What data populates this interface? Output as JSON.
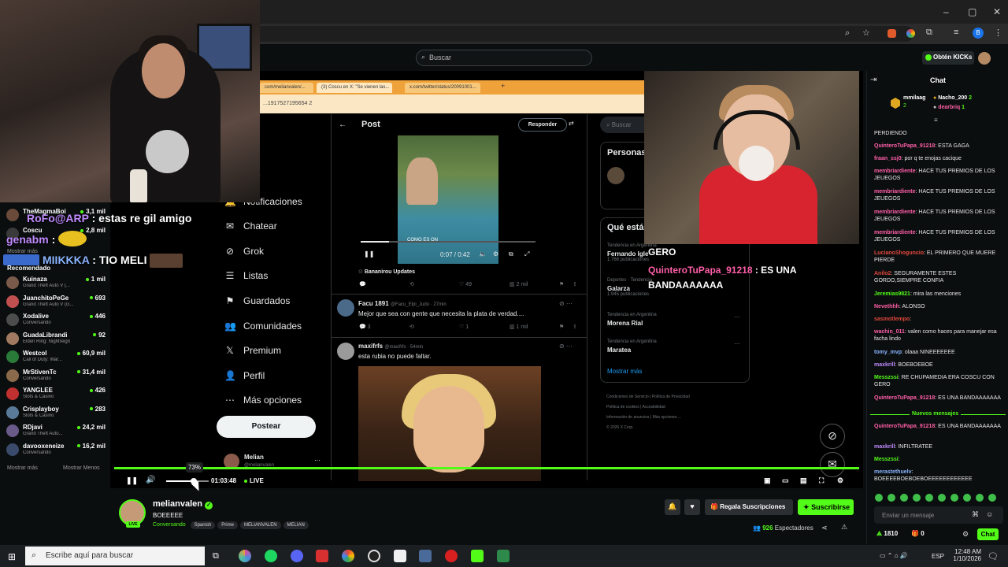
{
  "browser": {
    "controls": {
      "minimize": "–",
      "maximize": "▢",
      "close": "✕"
    },
    "profile_letter": "B"
  },
  "kick": {
    "search_placeholder": "Buscar",
    "kicks_button": "Obtén KICKs"
  },
  "webcam_overlay": {
    "lines": [
      {
        "user": "RoFo@ARP",
        "text": " : estas re gil amigo"
      },
      {
        "user": "genabm",
        "text": " :"
      },
      {
        "user": "MIIKKKA",
        "text": " : TIO MELI"
      }
    ]
  },
  "sidebar": {
    "top_items": [
      {
        "name": "TheMagmaBoi",
        "count": "3,1 mil"
      },
      {
        "name": "Coscu",
        "count": "2,8 mil"
      }
    ],
    "show_more_top": "Mostrar más",
    "recommended_label": "Recomendado",
    "recommended": [
      {
        "name": "Kuinaza",
        "game": "Grand Theft Auto V (...",
        "count": "1 mil",
        "color": "#7a5a48"
      },
      {
        "name": "JuanchitoPeGe",
        "game": "Grand Theft Auto V (G...",
        "count": "693",
        "color": "#c05050"
      },
      {
        "name": "Xodalive",
        "game": "Conversando",
        "count": "446",
        "color": "#4c4c4c"
      },
      {
        "name": "GuadaLibrandi",
        "game": "Elden Ring: Nightreign",
        "count": "92",
        "color": "#a07a60"
      },
      {
        "name": "Westcol",
        "game": "Call of Duty: War...",
        "count": "60,9 mil",
        "color": "#2a7a3a"
      },
      {
        "name": "MrStivenTc",
        "game": "Conversando",
        "count": "31,4 mil",
        "color": "#8a6a4a"
      },
      {
        "name": "YANGLEE",
        "game": "Slots & Casino",
        "count": "426",
        "color": "#c03030"
      },
      {
        "name": "Crisplayboy",
        "game": "Slots & Casino",
        "count": "283",
        "color": "#5a7a9a"
      },
      {
        "name": "RDjavi",
        "game": "Grand Theft Auto...",
        "count": "24,2 mil",
        "color": "#6a5a8a"
      },
      {
        "name": "davooxeneize",
        "game": "Conversando",
        "count": "16,2 mil",
        "color": "#3a4a6a"
      }
    ],
    "show_more": "Mostrar más",
    "show_less": "Mostrar Menos"
  },
  "x_screen": {
    "tabs": [
      "com/melianvalen/...",
      "(3) Coscu en X: \"Se vienen las...",
      "x.com/twitter/status/20091001..."
    ],
    "address": "...1917527195654 2",
    "nav": [
      {
        "icon": "⌂",
        "label": "o"
      },
      {
        "icon": "⌕",
        "label": "orar"
      },
      {
        "icon": "🔔",
        "label": "Notificaciones"
      },
      {
        "icon": "✉",
        "label": "Chatear"
      },
      {
        "icon": "⊘",
        "label": "Grok"
      },
      {
        "icon": "☰",
        "label": "Listas"
      },
      {
        "icon": "⚑",
        "label": "Guardados"
      },
      {
        "icon": "👥",
        "label": "Comunidades"
      },
      {
        "icon": "𝕏",
        "label": "Premium"
      },
      {
        "icon": "👤",
        "label": "Perfil"
      },
      {
        "icon": "⋯",
        "label": "Más opciones"
      }
    ],
    "post_button": "Postear",
    "account_name": "Melian",
    "account_handle": "@melianvalen",
    "header": "Post",
    "reply_button": "Responder",
    "video_caption": "COMO ES ON",
    "video_time": "0:07 / 0:42",
    "source": "Bananirou Updates",
    "post1_stats": [
      "",
      "",
      "49",
      "2 mil"
    ],
    "reply1": {
      "name": "Facu 1891",
      "handle": "@Facu_Elpi_Judo · 27min",
      "text": "Mejor que sea con gente que necesita la plata de verdad....",
      "stats": [
        "3",
        "",
        "1",
        "1 mil"
      ]
    },
    "reply2": {
      "name": "maxifrfs",
      "handle": "@maxifrfs · 54min",
      "text": "esta rubia no puede faltar."
    },
    "search": "Buscar",
    "people": "Personas",
    "whats_happening": "Qué está",
    "trends": [
      {
        "ctx": "Tendencia en Argentina",
        "name": "Fernando Igle",
        "posts": "1.768 publicaciones"
      },
      {
        "ctx": "Deportes · Tendencia",
        "name": "Galarza",
        "posts": "1.945 publicaciones"
      },
      {
        "ctx": "Tendencia en Argentina",
        "name": "Morena Rial",
        "posts": ""
      },
      {
        "ctx": "Tendencia en Argentina",
        "name": "Maratea",
        "posts": ""
      }
    ],
    "show_more": "Mostrar más",
    "footer": [
      "Condiciones de Servicio",
      "Política de Privacidad",
      "Política de cookies",
      "Accesibilidad",
      "Información de anuncios",
      "Más opciones ...",
      "© 2026 X Corp."
    ]
  },
  "cam2_overlay": {
    "top": "GERO",
    "user": "QuinteroTuPapa_91218",
    "text": " : ES UNA BANDAAAAAAA"
  },
  "player": {
    "volume_percent": 73,
    "volume_label": "73%",
    "time": "01:03:48",
    "live": "LIVE"
  },
  "channel": {
    "name": "melianvalen",
    "title": "BOEEEEE",
    "category": "Conversando",
    "tags": [
      "Spanish",
      "Prime",
      "MELIANVALEN",
      "MELIAN"
    ],
    "live_badge": "LIVE",
    "gift_button": "Regala Suscripciones",
    "subscribe_button": "Suscribirse",
    "viewers": "926",
    "viewers_label": "Espectadores"
  },
  "chat": {
    "title": "Chat",
    "leaders": [
      {
        "name": "mmilaag",
        "score": "2"
      },
      {
        "name": "Nacho_200",
        "score": "2"
      },
      {
        "name": "dearbriq",
        "score": "1"
      }
    ],
    "messages": [
      {
        "user": "",
        "color": "#e6e6e6",
        "text": "PERDIENDO"
      },
      {
        "user": "QuinteroTuPapa_91218",
        "color": "#ff5fa8",
        "text": ": ESTA GAGA"
      },
      {
        "user": "fraan_ssj0",
        "color": "#ff5fa8",
        "text": ": por q te enojas cacique"
      },
      {
        "user": "membriardiente",
        "color": "#ff5fa8",
        "text": ": HACE TUS PREMIOS DE LOS JEUEGOS"
      },
      {
        "user": "membriardiente",
        "color": "#ff5fa8",
        "text": ": HACE TUS PREMIOS DE LOS JEUEGOS"
      },
      {
        "user": "membriardiente",
        "color": "#ff5fa8",
        "text": ": HACE TUS PREMIOS DE LOS JEUEGOS"
      },
      {
        "user": "membriardiente",
        "color": "#ff5fa8",
        "text": ": HACE TUS PREMIOS DE LOS JEUEGOS"
      },
      {
        "user": "LucianoShoguncio",
        "color": "#e0483c",
        "text": ": EL PRIMERO QUE MUERE PIERDE"
      },
      {
        "user": "Anilo2",
        "color": "#e0483c",
        "text": ": SEGURAMENTE ESTES GORDO,SIEMPRE CONFIA"
      },
      {
        "user": "Jeremias9821",
        "color": "#53fc18",
        "text": ": mira las menciones"
      },
      {
        "user": "Nevethhh",
        "color": "#ff5fa8",
        "text": ": ALONSO"
      },
      {
        "user": "sasmotlempo",
        "color": "#e0483c",
        "text": ":"
      },
      {
        "user": "wachin_011",
        "color": "#ff5fa8",
        "text": ": valen como haces para manejar esa facha lindo"
      },
      {
        "user": "tomy_mvp",
        "color": "#8ab4ff",
        "text": ": olaaa NINEEEEEEE"
      },
      {
        "user": "maxkrill",
        "color": "#c08aff",
        "text": ": BOEBOEBOE"
      },
      {
        "user": "Messzssi",
        "color": "#53fc18",
        "text": ": RE CHUPAMEDIA ERA COSCU CON GERO"
      },
      {
        "user": "QuinteroTuPapa_91218",
        "color": "#ff5fa8",
        "text": ": ES UNA BANDAAAAAAA"
      }
    ],
    "new_messages": "Nuevos mensajes",
    "messages_after": [
      {
        "user": "QuinteroTuPapa_91218",
        "color": "#ff5fa8",
        "text": ": ES UNA BANDAAAAAAA"
      },
      {
        "user": "maxkrill",
        "color": "#c08aff",
        "text": ": INFILTRATEE"
      },
      {
        "user": "Messzssi",
        "color": "#53fc18",
        "text": ":"
      },
      {
        "user": "merastethuelv",
        "color": "#8ab4ff",
        "text": ": BOEEEEBOEBOEBOEEEEEEEEEEEE"
      }
    ],
    "input_placeholder": "Enviar un mensaje",
    "points": "1810",
    "zero": "0",
    "chat_button": "Chat"
  },
  "taskbar": {
    "search_placeholder": "Escribe aquí para buscar",
    "lang": "ESP",
    "time": "12:48 AM",
    "date": "1/10/2026"
  }
}
